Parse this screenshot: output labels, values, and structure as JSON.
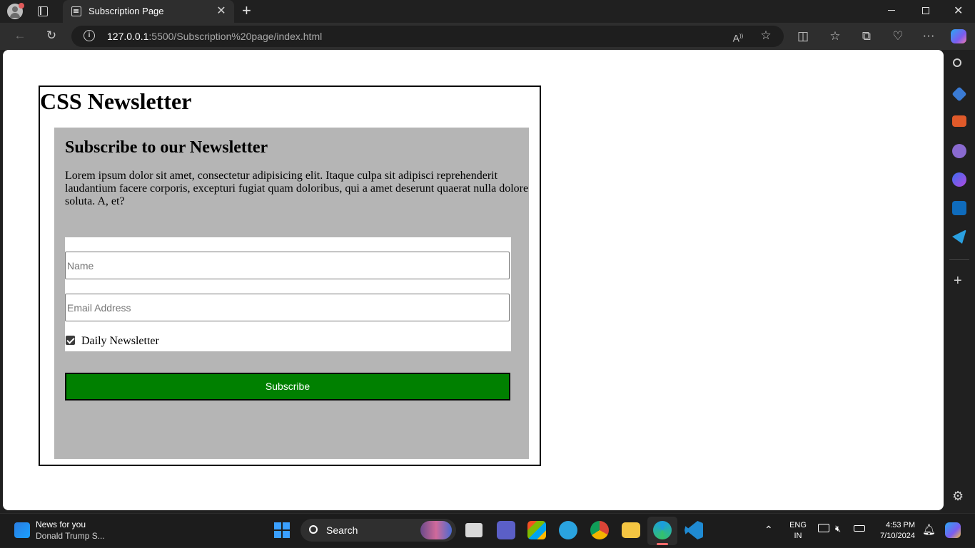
{
  "browser": {
    "tab_title": "Subscription Page",
    "url_host": "127.0.0.1",
    "url_rest": ":5500/Subscription%20page/index.html"
  },
  "page": {
    "heading": "CSS Newsletter",
    "panel_heading": "Subscribe to our Newsletter",
    "panel_text": "Lorem ipsum dolor sit amet, consectetur adipisicing elit. Itaque culpa sit adipisci reprehenderit laudantium facere corporis, excepturi fugiat quam doloribus, qui a amet deserunt quaerat nulla dolore soluta. A, et?",
    "name_placeholder": "Name",
    "email_placeholder": "Email Address",
    "checkbox_label": "Daily Newsletter",
    "checkbox_checked": true,
    "subscribe_label": "Subscribe",
    "subscribe_color": "#008000",
    "panel_color": "#b5b5b5"
  },
  "taskbar": {
    "news_title": "News for you",
    "news_subtitle": "Donald Trump S...",
    "search_label": "Search",
    "lang_line1": "ENG",
    "lang_line2": "IN",
    "time": "4:53 PM",
    "date": "7/10/2024"
  }
}
